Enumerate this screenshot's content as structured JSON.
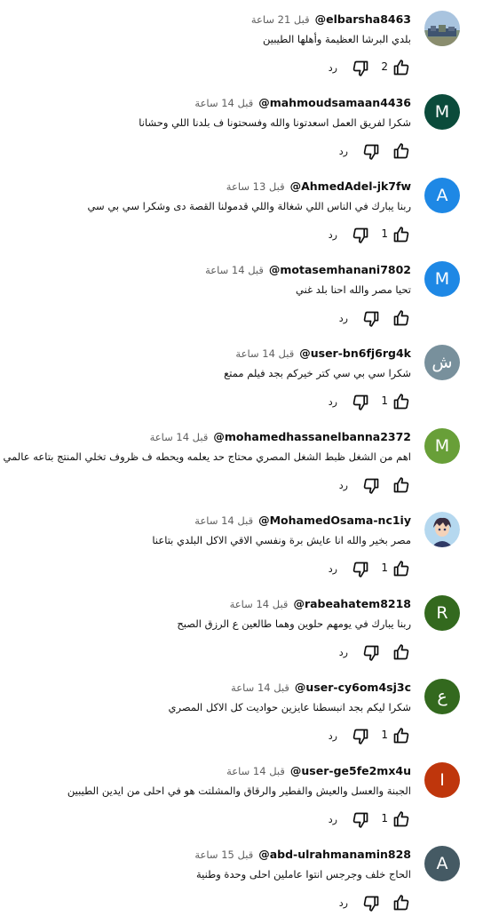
{
  "ui": {
    "reply_label": "رد"
  },
  "comments": [
    {
      "author": "@elbarsha8463",
      "time": "قبل 21 ساعة",
      "text": "بلدي البرشا العظيمة وأهلها الطيبين",
      "likes": "2",
      "avatar": {
        "type": "photo",
        "letter": ""
      }
    },
    {
      "author": "@mahmoudsamaan4436",
      "time": "قبل 14 ساعة",
      "text": "شكرا لفريق العمل اسعدتونا والله وفسحتونا ف بلدنا اللي وحشانا",
      "likes": "",
      "avatar": {
        "type": "letter",
        "letter": "M",
        "color": "#0b4b3b"
      }
    },
    {
      "author": "@AhmedAdel-jk7fw",
      "time": "قبل 13 ساعة",
      "text": "ربنا يبارك في الناس اللي شغالة واللي قدمولنا القصة دى وشكرا سي بي سي",
      "likes": "1",
      "avatar": {
        "type": "letter",
        "letter": "A",
        "color": "#1e88e5"
      }
    },
    {
      "author": "@motasemhanani7802",
      "time": "قبل 14 ساعة",
      "text": "تحيا مصر والله احنا بلد غني",
      "likes": "",
      "avatar": {
        "type": "letter",
        "letter": "M",
        "color": "#1e88e5"
      }
    },
    {
      "author": "@user-bn6fj6rg4k",
      "time": "قبل 14 ساعة",
      "text": "شكرا سي بي سي كتر خيركم بجد فيلم ممتع",
      "likes": "1",
      "avatar": {
        "type": "letter",
        "letter": "ش",
        "color": "#78909c"
      }
    },
    {
      "author": "@mohamedhassanelbanna2372",
      "time": "قبل 14 ساعة",
      "text": "اهم من الشغل ظبط الشغل المصري محتاج حد يعلمه ويحطه ف ظروف تخلي المنتج بتاعه عالمي",
      "likes": "",
      "avatar": {
        "type": "letter",
        "letter": "M",
        "color": "#689f38"
      }
    },
    {
      "author": "@MohamedOsama-nc1iy",
      "time": "قبل 14 ساعة",
      "text": "مصر بخير والله انا عايش برة ونفسي الاقي الاكل البلدي بتاعنا",
      "likes": "1",
      "avatar": {
        "type": "anime",
        "letter": ""
      }
    },
    {
      "author": "@rabeahatem8218",
      "time": "قبل 14 ساعة",
      "text": "ربنا يبارك في يومهم حلوين وهما طالعين ع الرزق الصبح",
      "likes": "",
      "avatar": {
        "type": "letter",
        "letter": "R",
        "color": "#33691e"
      }
    },
    {
      "author": "@user-cy6om4sj3c",
      "time": "قبل 14 ساعة",
      "text": "شكرا ليكم بجد انبسطنا عايزين حواديت كل الاكل المصري",
      "likes": "1",
      "avatar": {
        "type": "letter",
        "letter": "ع",
        "color": "#33691e"
      }
    },
    {
      "author": "@user-ge5fe2mx4u",
      "time": "قبل 14 ساعة",
      "text": "الجبنة والعسل والعيش والفطير والرقاق والمشلتت هو في احلى من ايدين الطيبين",
      "likes": "1",
      "avatar": {
        "type": "letter",
        "letter": "I",
        "color": "#bf360c"
      }
    },
    {
      "author": "@abd-ulrahmanamin828",
      "time": "قبل 15 ساعة",
      "text": "الحاج خلف وجرجس انتوا عاملين احلى وحدة وطنية",
      "likes": "",
      "avatar": {
        "type": "letter",
        "letter": "A",
        "color": "#455a64"
      }
    }
  ]
}
